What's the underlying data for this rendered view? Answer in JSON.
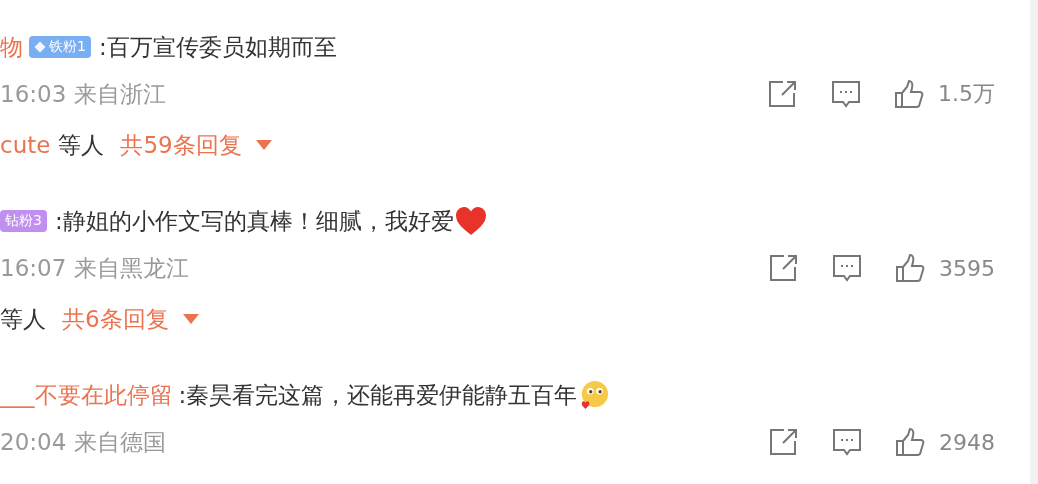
{
  "comments": [
    {
      "author": "物",
      "badge": {
        "label": "铁粉1",
        "kind": "iron"
      },
      "text": ":百万宣传委员如期而至",
      "meta": "16:03 来自浙江",
      "likes": "1.5万",
      "replies": {
        "names": "cute",
        "suffix": "等人",
        "count": "共59条回复"
      }
    },
    {
      "badge": {
        "label": "钻粉3",
        "kind": "diamond"
      },
      "text": ":静姐的小作文写的真棒！细腻，我好爱",
      "emoji": {
        "kind": "heart"
      },
      "meta": "16:07 来自黑龙江",
      "likes": "3595",
      "replies": {
        "suffix": "等人",
        "count": "共6条回复"
      }
    },
    {
      "author": "___不要在此停留",
      "text": ":秦昊看完这篇，还能再爱伊能静五百年",
      "emoji": {
        "kind": "blush"
      },
      "meta": "20:04 来自德国",
      "likes": "2948"
    }
  ]
}
